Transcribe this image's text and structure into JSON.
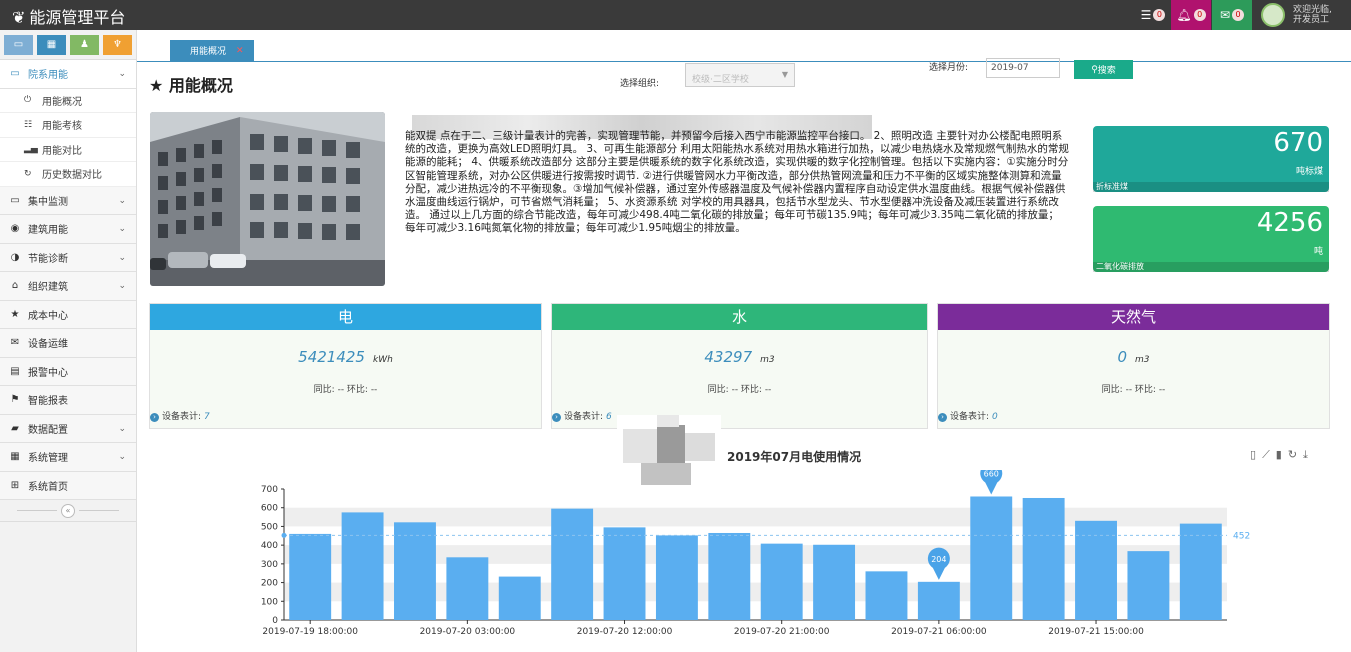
{
  "app": {
    "title": "能源管理平台"
  },
  "topbar": {
    "list_badge": "0",
    "bell_badge": "0",
    "mail_badge": "0",
    "user_greeting": "欢迎光临,",
    "user_name": "开发员工"
  },
  "sidebar": {
    "shortcut_icons": [
      "monitor-icon",
      "grid-icon",
      "user-icon",
      "cart-icon"
    ],
    "active_group": {
      "label": "院系用能",
      "icon": "monitor-icon"
    },
    "subitems": [
      {
        "label": "用能概况",
        "icon": "power-icon"
      },
      {
        "label": "用能考核",
        "icon": "list-icon"
      },
      {
        "label": "用能对比",
        "icon": "bar-signal-icon"
      },
      {
        "label": "历史数据对比",
        "icon": "refresh-icon"
      }
    ],
    "items": [
      {
        "label": "集中监测",
        "icon": "monitor-icon",
        "chevron": true
      },
      {
        "label": "建筑用能",
        "icon": "globe-icon",
        "chevron": true
      },
      {
        "label": "节能诊断",
        "icon": "half-circle-icon",
        "chevron": true
      },
      {
        "label": "组织建筑",
        "icon": "home-icon",
        "chevron": true
      },
      {
        "label": "成本中心",
        "icon": "star-icon",
        "chevron": false
      },
      {
        "label": "设备运维",
        "icon": "envelope-icon",
        "chevron": false
      },
      {
        "label": "报警中心",
        "icon": "list-box-icon",
        "chevron": false
      },
      {
        "label": "智能报表",
        "icon": "flag-icon",
        "chevron": false
      },
      {
        "label": "数据配置",
        "icon": "book-icon",
        "chevron": true
      },
      {
        "label": "系统管理",
        "icon": "grid-small-icon",
        "chevron": true
      },
      {
        "label": "系统首页",
        "icon": "windows-icon",
        "chevron": false
      }
    ]
  },
  "tabs": [
    {
      "label": "用能概况",
      "close": "✕"
    }
  ],
  "page": {
    "title": "用能概况",
    "org_label": "选择组织:",
    "org_value": "校级·二区学校",
    "month_label": "选择月份:",
    "month_value": "2019-07",
    "search_label": "搜索"
  },
  "description": "能双提 点在于二、三级计量表计的完善，实现管理节能，并预留今后接入西宁市能源监控平台接口。 2、照明改造 主要针对办公楼配电照明系统的改造，更换为高效LED照明灯具。 3、可再生能源部分 利用太阳能热水系统对用热水箱进行加热，以减少电热烧水及常规燃气制热水的常规能源的能耗； 4、供暖系统改造部分 这部分主要是供暖系统的数字化系统改造，实现供暖的数字化控制管理。包括以下实施内容：①实施分时分区智能管理系统，对办公区供暖进行按需按时调节. ②进行供暖管网水力平衡改造，部分供热管网流量和压力不平衡的区域实施整体测算和流量分配，减少进热远冷的不平衡现象。③增加气候补偿器，通过室外传感器温度及气候补偿器内置程序自动设定供水温度曲线。根据气候补偿器供水温度曲线运行锅炉，可节省燃气消耗量； 5、水资源系统 对学校的用具器具，包括节水型龙头、节水型便器冲洗设备及减压装置进行系统改造。 通过以上几方面的综合节能改造，每年可减少498.4吨二氧化碳的排放量；每年可节碳135.9吨；每年可减少3.35吨二氧化硫的排放量；每年可减少3.16吨氮氧化物的排放量；每年可减少1.95吨烟尘的排放量。",
  "metrics": [
    {
      "value": "670",
      "unit": "吨标煤",
      "label": "折标准煤",
      "color": "#1fa89a"
    },
    {
      "value": "4256",
      "unit": "吨",
      "label": "二氧化碳排放",
      "color": "#2fba71"
    }
  ],
  "stats": [
    {
      "title": "电",
      "value": "5421425",
      "unit": "kWh",
      "compare": "同比: --   环比: --",
      "meter_label": "设备表计:",
      "meter_count": "7",
      "color": "#2ea7e0"
    },
    {
      "title": "水",
      "value": "43297",
      "unit": "m3",
      "compare": "同比: --   环比: --",
      "meter_label": "设备表计:",
      "meter_count": "6",
      "color": "#2eb67a"
    },
    {
      "title": "天然气",
      "value": "0",
      "unit": "m3",
      "compare": "同比: --   环比: --",
      "meter_label": "设备表计:",
      "meter_count": "0",
      "color": "#7b2c9a"
    }
  ],
  "chart_tools": [
    "document-icon",
    "line-chart-icon",
    "bar-chart-icon",
    "restore-icon",
    "download-icon"
  ],
  "chart_data": {
    "type": "bar",
    "title": "2019年07月电使用情况",
    "bar_color": "#5aaef0",
    "ylim": [
      0,
      700
    ],
    "yticks": [
      0,
      100,
      200,
      300,
      400,
      500,
      600,
      700
    ],
    "xtick_labels": [
      "2019-07-19 18:00:00",
      "2019-07-20 03:00:00",
      "2019-07-20 12:00:00",
      "2019-07-20 21:00:00",
      "2019-07-21 06:00:00",
      "2019-07-21 15:00:00"
    ],
    "values": [
      460,
      575,
      522,
      335,
      232,
      595,
      495,
      452,
      465,
      408,
      402,
      260,
      204,
      660,
      652,
      530,
      368,
      515
    ],
    "markers": [
      {
        "label": "660",
        "index": 13
      },
      {
        "label": "204",
        "index": 12
      }
    ],
    "average": {
      "label": "452",
      "value": 452
    },
    "grid": true
  }
}
